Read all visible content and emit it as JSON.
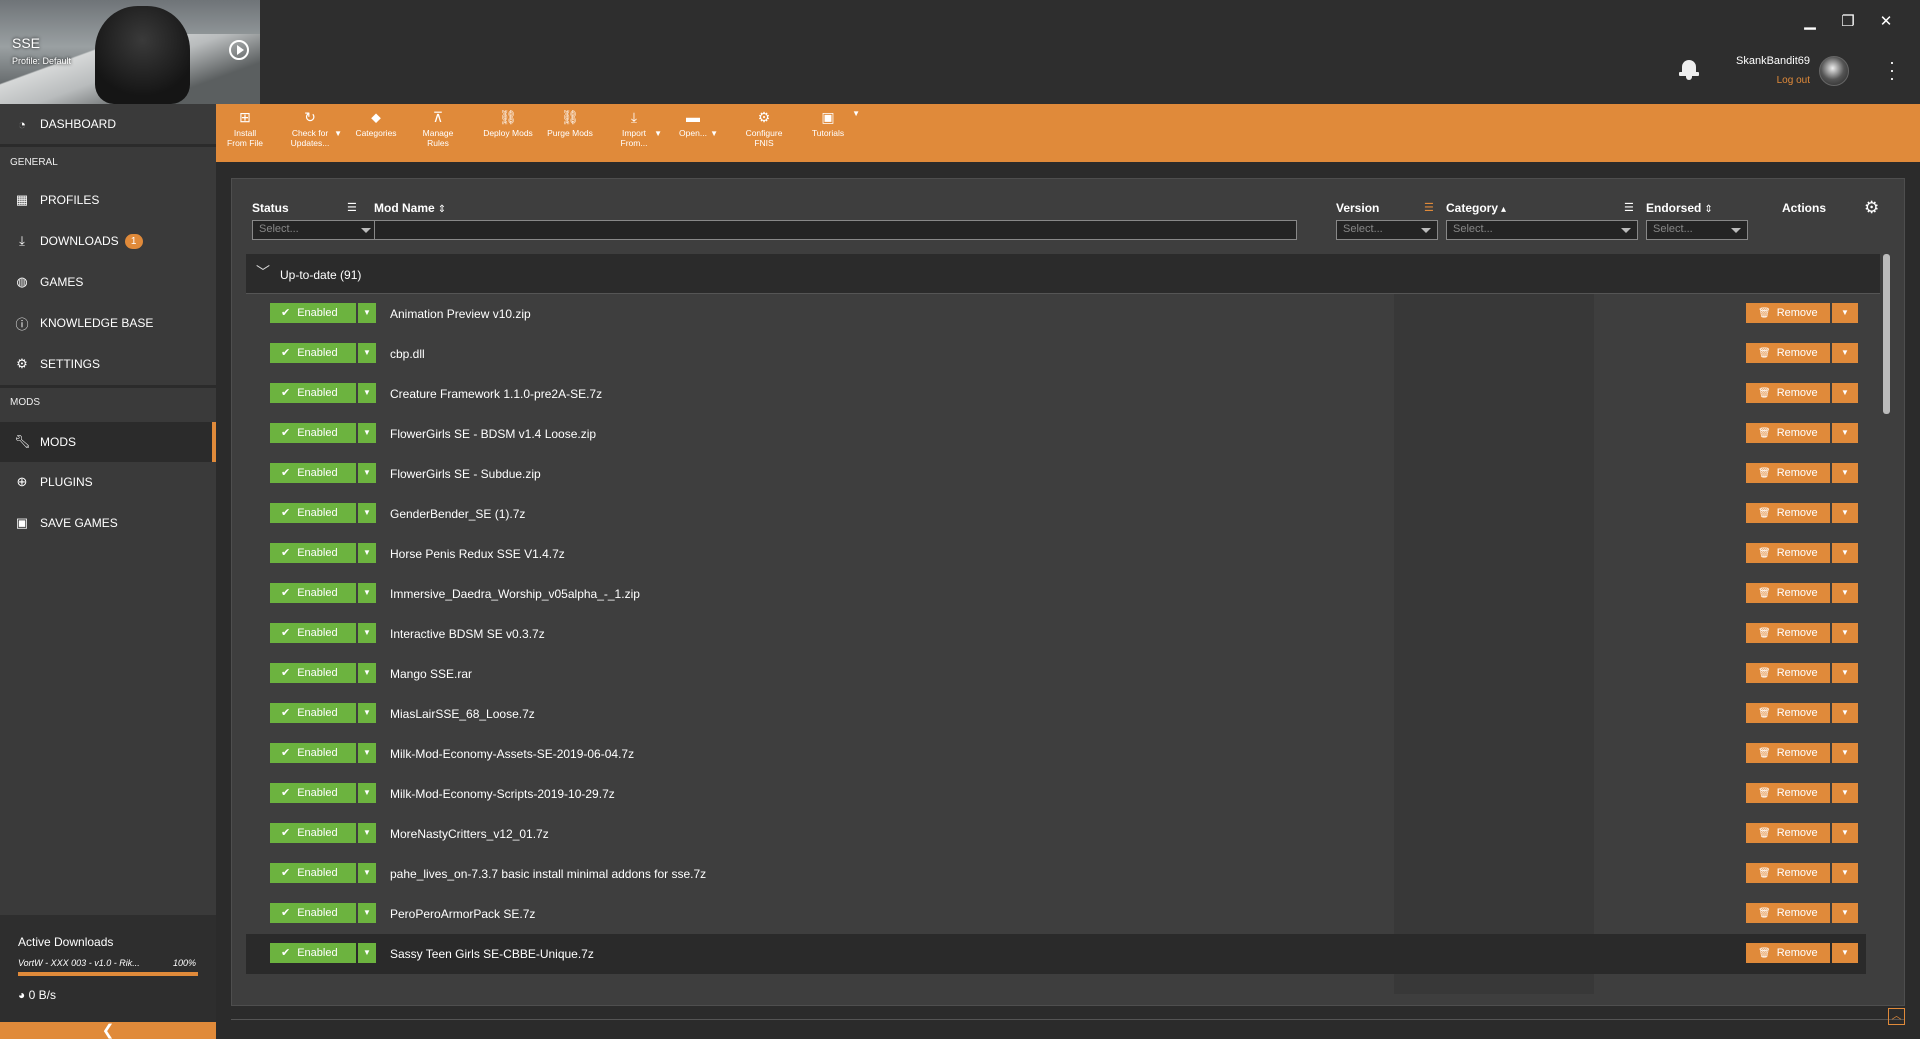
{
  "header": {
    "game_title": "SSE",
    "profile": "Profile: Default",
    "username": "SkankBandit69",
    "logout": "Log out",
    "window_buttons": {
      "minimize": "▁",
      "restore": "❐",
      "close": "✕"
    }
  },
  "sidebar": {
    "dashboard": "DASHBOARD",
    "general_section": "GENERAL",
    "general_items": [
      {
        "label": "PROFILES",
        "icon": "profiles-icon"
      },
      {
        "label": "DOWNLOADS",
        "icon": "download-icon",
        "badge": "1"
      },
      {
        "label": "GAMES",
        "icon": "gamepad-icon"
      },
      {
        "label": "KNOWLEDGE BASE",
        "icon": "info-icon"
      },
      {
        "label": "SETTINGS",
        "icon": "gear-icon"
      }
    ],
    "mods_section": "MODS",
    "mods_items": [
      {
        "label": "MODS",
        "icon": "wrench-icon",
        "active": true
      },
      {
        "label": "PLUGINS",
        "icon": "plus-circle-icon"
      },
      {
        "label": "SAVE GAMES",
        "icon": "floppy-icon"
      }
    ],
    "active_downloads": {
      "title": "Active Downloads",
      "file": "VortW - XXX 003 - v1.0 - Rik...",
      "percent": "100%",
      "progress": 1.0,
      "speed": "0 B/s"
    }
  },
  "toolbar": {
    "install_from_file": "Install From File",
    "check_for_updates": "Check for Updates...",
    "categories": "Categories",
    "manage_rules": "Manage Rules",
    "deploy_mods": "Deploy Mods",
    "purge_mods": "Purge Mods",
    "import_from": "Import From...",
    "open": "Open...",
    "configure_fnis": "Configure FNIS",
    "tutorials": "Tutorials"
  },
  "table": {
    "columns": {
      "status": "Status",
      "mod_name": "Mod Name",
      "version": "Version",
      "category": "Category",
      "endorsed": "Endorsed",
      "actions": "Actions"
    },
    "select_placeholder": "Select...",
    "group_label": "Up-to-date (91)",
    "enabled_label": "Enabled",
    "remove_label": "Remove",
    "rows": [
      "Animation Preview v10.zip",
      "cbp.dll",
      "Creature Framework 1.1.0-pre2A-SE.7z",
      "FlowerGirls SE - BDSM v1.4 Loose.zip",
      "FlowerGirls SE - Subdue.zip",
      "GenderBender_SE (1).7z",
      "Horse Penis Redux SSE V1.4.7z",
      "Immersive_Daedra_Worship_v05alpha_-_1.zip",
      "Interactive BDSM SE v0.3.7z",
      "Mango SSE.rar",
      "MiasLairSSE_68_Loose.7z",
      "Milk-Mod-Economy-Assets-SE-2019-06-04.7z",
      "Milk-Mod-Economy-Scripts-2019-10-29.7z",
      "MoreNastyCritters_v12_01.7z",
      "pahe_lives_on-7.3.7 basic install minimal addons for sse.7z",
      "PeroPeroArmorPack SE.7z",
      "Sassy Teen Girls SE-CBBE-Unique.7z"
    ],
    "selected_row": 16
  },
  "colors": {
    "accent": "#e08a3a",
    "enabled": "#6cb33f",
    "sidebar_bg": "#3a3a3a",
    "main_bg": "#2b2b2b"
  }
}
